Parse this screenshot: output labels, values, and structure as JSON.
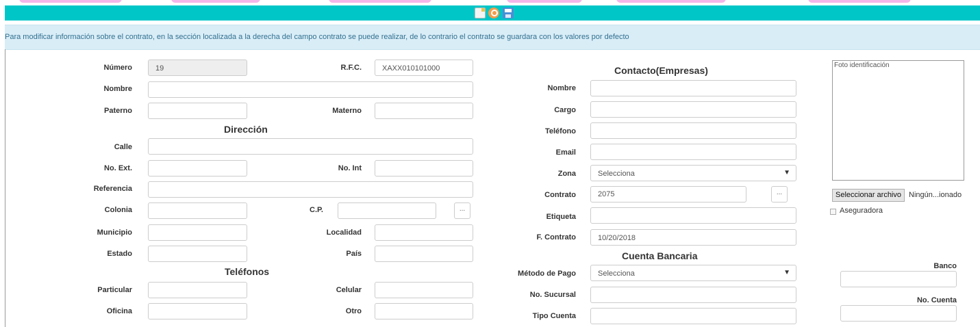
{
  "toolbar": {
    "icons": [
      "new-document-icon",
      "search-icon",
      "save-icon"
    ],
    "colors": {
      "bar": "#00c6c8",
      "info_bg": "#d9edf7",
      "info_text": "#31708f"
    }
  },
  "info": {
    "message": "Para modificar información sobre el contrato, en la sección localizada a la derecha del campo contrato se puede realizar, de lo contrario el contrato se guardara con los valores por defecto"
  },
  "client": {
    "numero_label": "Número",
    "numero_value": "19",
    "rfc_label": "R.F.C.",
    "rfc_value": "XAXX010101000",
    "nombre_label": "Nombre",
    "paterno_label": "Paterno",
    "materno_label": "Materno"
  },
  "direccion": {
    "title": "Dirección",
    "calle_label": "Calle",
    "noext_label": "No. Ext.",
    "noint_label": "No. Int",
    "referencia_label": "Referencia",
    "colonia_label": "Colonia",
    "cp_label": "C.P.",
    "lookup_label": "...",
    "municipio_label": "Municipio",
    "localidad_label": "Localidad",
    "estado_label": "Estado",
    "pais_label": "País"
  },
  "telefonos": {
    "title": "Teléfonos",
    "particular_label": "Particular",
    "celular_label": "Celular",
    "oficina_label": "Oficina",
    "otro_label": "Otro"
  },
  "contacto": {
    "title": "Contacto(Empresas)",
    "nombre_label": "Nombre",
    "cargo_label": "Cargo",
    "telefono_label": "Teléfono",
    "email_label": "Email",
    "zona_label": "Zona",
    "zona_value": "Selecciona",
    "contrato_label": "Contrato",
    "contrato_value": "2075",
    "contrato_btn": "...",
    "etiqueta_label": "Etiqueta",
    "fcontrato_label": "F. Contrato",
    "fcontrato_value": "10/20/2018"
  },
  "cuenta": {
    "title": "Cuenta Bancaria",
    "metodo_label": "Método de Pago",
    "metodo_value": "Selecciona",
    "sucursal_label": "No. Sucursal",
    "tipo_label": "Tipo Cuenta",
    "banco_label": "Banco",
    "nocuenta_label": "No. Cuenta"
  },
  "photo": {
    "alt": "Foto identificación",
    "file_button": "Seleccionar archivo",
    "file_name": "Ningún...ionado",
    "aseguradora_label": "Aseguradora"
  }
}
